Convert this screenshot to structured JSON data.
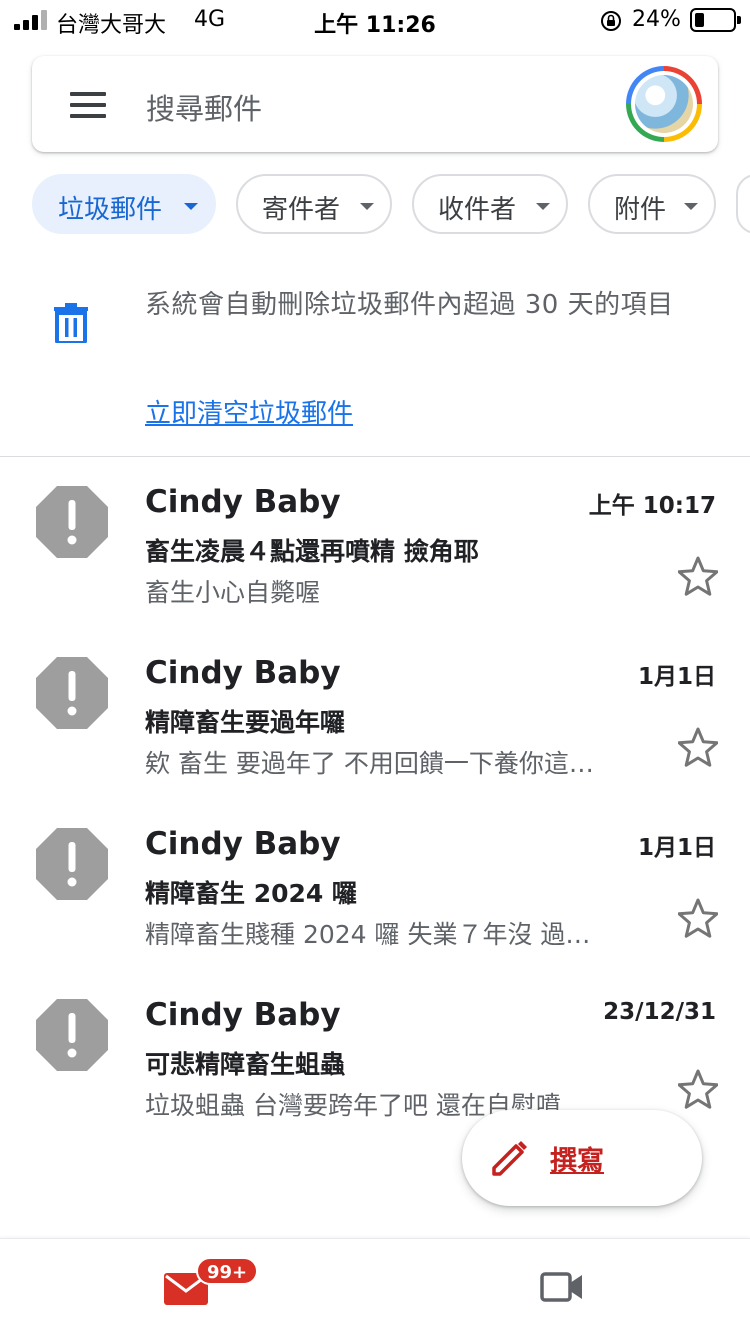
{
  "status_bar": {
    "carrier": "台灣大哥大",
    "network": "4G",
    "time": "上午 11:26",
    "battery_percent": "24%",
    "battery_level": 0.24
  },
  "search": {
    "placeholder": "搜尋郵件",
    "menu_icon": "hamburger-menu-icon",
    "avatar_icon": "account-avatar"
  },
  "chips": [
    {
      "label": "垃圾郵件",
      "active": true
    },
    {
      "label": "寄件者",
      "active": false
    },
    {
      "label": "收件者",
      "active": false
    },
    {
      "label": "附件",
      "active": false
    }
  ],
  "trash_notice": {
    "icon": "trash-icon",
    "text": "系統會自動刪除垃圾郵件內超過 30 天的項目",
    "action_label": "立即清空垃圾郵件"
  },
  "emails": [
    {
      "sender": "Cindy Baby",
      "date": "上午 10:17",
      "subject": "畜生凌晨４點還再噴精 撿角耶",
      "snippet": "畜生小心自斃喔",
      "starred": false
    },
    {
      "sender": "Cindy Baby",
      "date": "1月1日",
      "subject": "精障畜生要過年囉",
      "snippet": "欸 畜生 要過年了 不用回饋一下養你這…",
      "starred": false
    },
    {
      "sender": "Cindy Baby",
      "date": "1月1日",
      "subject": "精障畜生 2024 囉",
      "snippet": "精障畜生賤種 2024 囉 失業７年沒 過…",
      "starred": false
    },
    {
      "sender": "Cindy Baby",
      "date": "23/12/31",
      "subject": "可悲精障畜生蛆蟲",
      "snippet": "垃圾蛆蟲 台灣要跨年了吧 還在自慰噴…",
      "starred": false
    }
  ],
  "compose": {
    "label": "撰寫",
    "icon": "pencil-icon"
  },
  "bottom_nav": {
    "mail_icon": "mail-icon",
    "mail_badge": "99+",
    "meet_icon": "video-camera-icon"
  },
  "colors": {
    "accent_blue": "#1a73e8",
    "chip_active_bg": "#e8f0fe",
    "compose_red": "#c5221f",
    "badge_red": "#d93025",
    "spam_icon_gray": "#9e9e9e"
  }
}
